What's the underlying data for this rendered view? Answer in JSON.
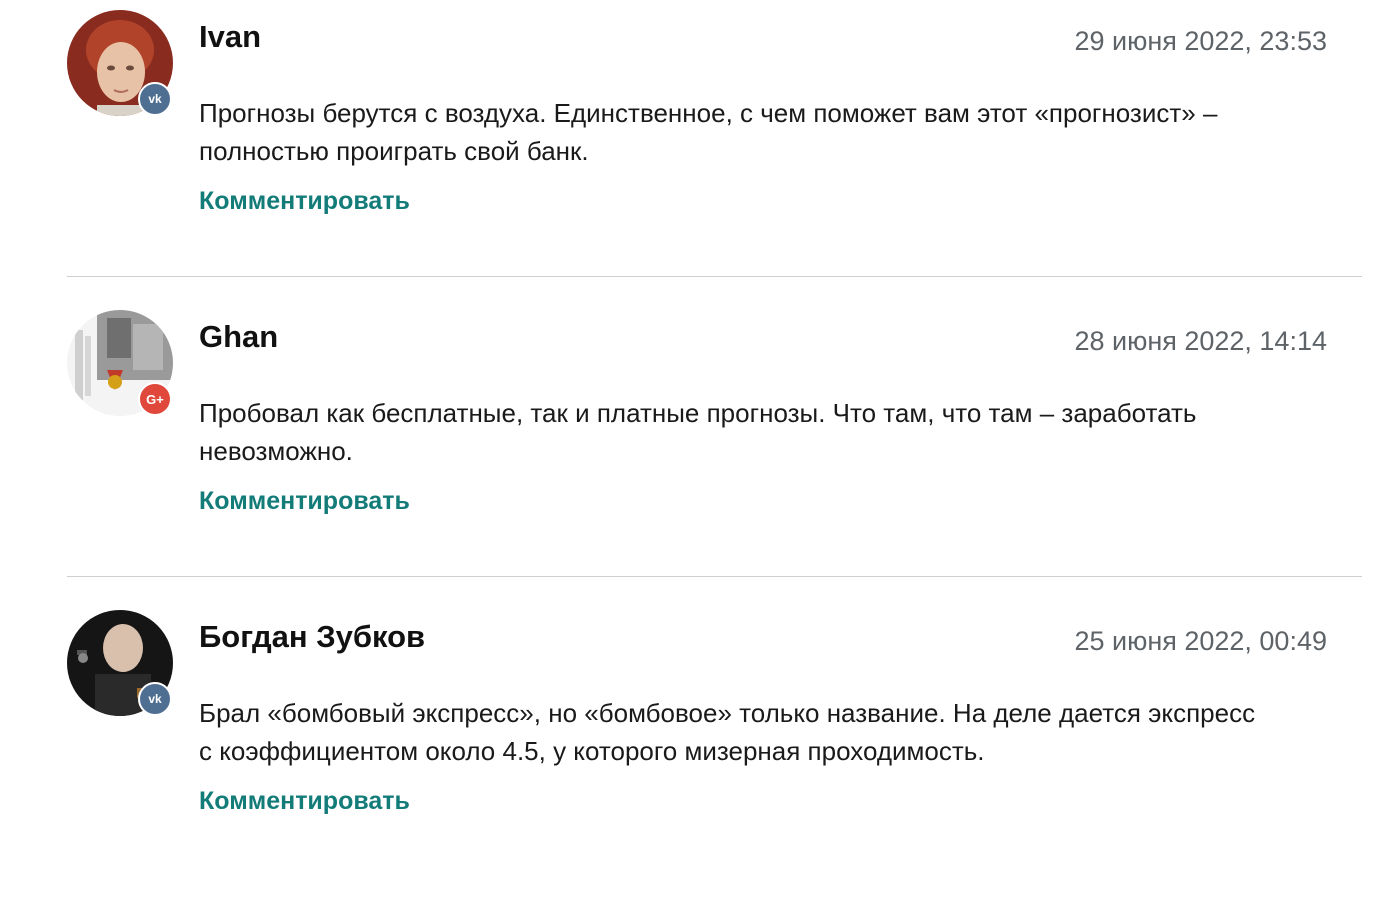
{
  "comments": [
    {
      "author": "Ivan",
      "date": "29 июня 2022, 23:53",
      "text": "Прогнозы берутся с воздуха. Единственное, с чем поможет вам этот «прогнозист» – полностью проиграть свой банк.",
      "reply_label": "Комментировать",
      "network": "vk",
      "badge_icon": "vk-icon",
      "badge_text": "vk"
    },
    {
      "author": "Ghan",
      "date": "28 июня 2022, 14:14",
      "text": "Пробовал как бесплатные, так и платные прогнозы. Что там, что там – заработать невозможно.",
      "reply_label": "Комментировать",
      "network": "google-plus",
      "badge_icon": "google-plus-icon",
      "badge_text": "G+"
    },
    {
      "author": "Богдан Зубков",
      "date": "25 июня 2022, 00:49",
      "text": "Брал «бомбовый экспресс», но «бомбовое» только название. На деле дается экспресс с коэффициентом около 4.5, у которого мизерная проходимость.",
      "reply_label": "Комментировать",
      "network": "vk",
      "badge_icon": "vk-icon",
      "badge_text": "vk"
    }
  ],
  "colors": {
    "reply_link": "#137c79",
    "date_text": "#5e6368",
    "divider": "#cfcfcf",
    "vk_badge": "#4e6e92",
    "gplus_badge": "#e0483b"
  }
}
